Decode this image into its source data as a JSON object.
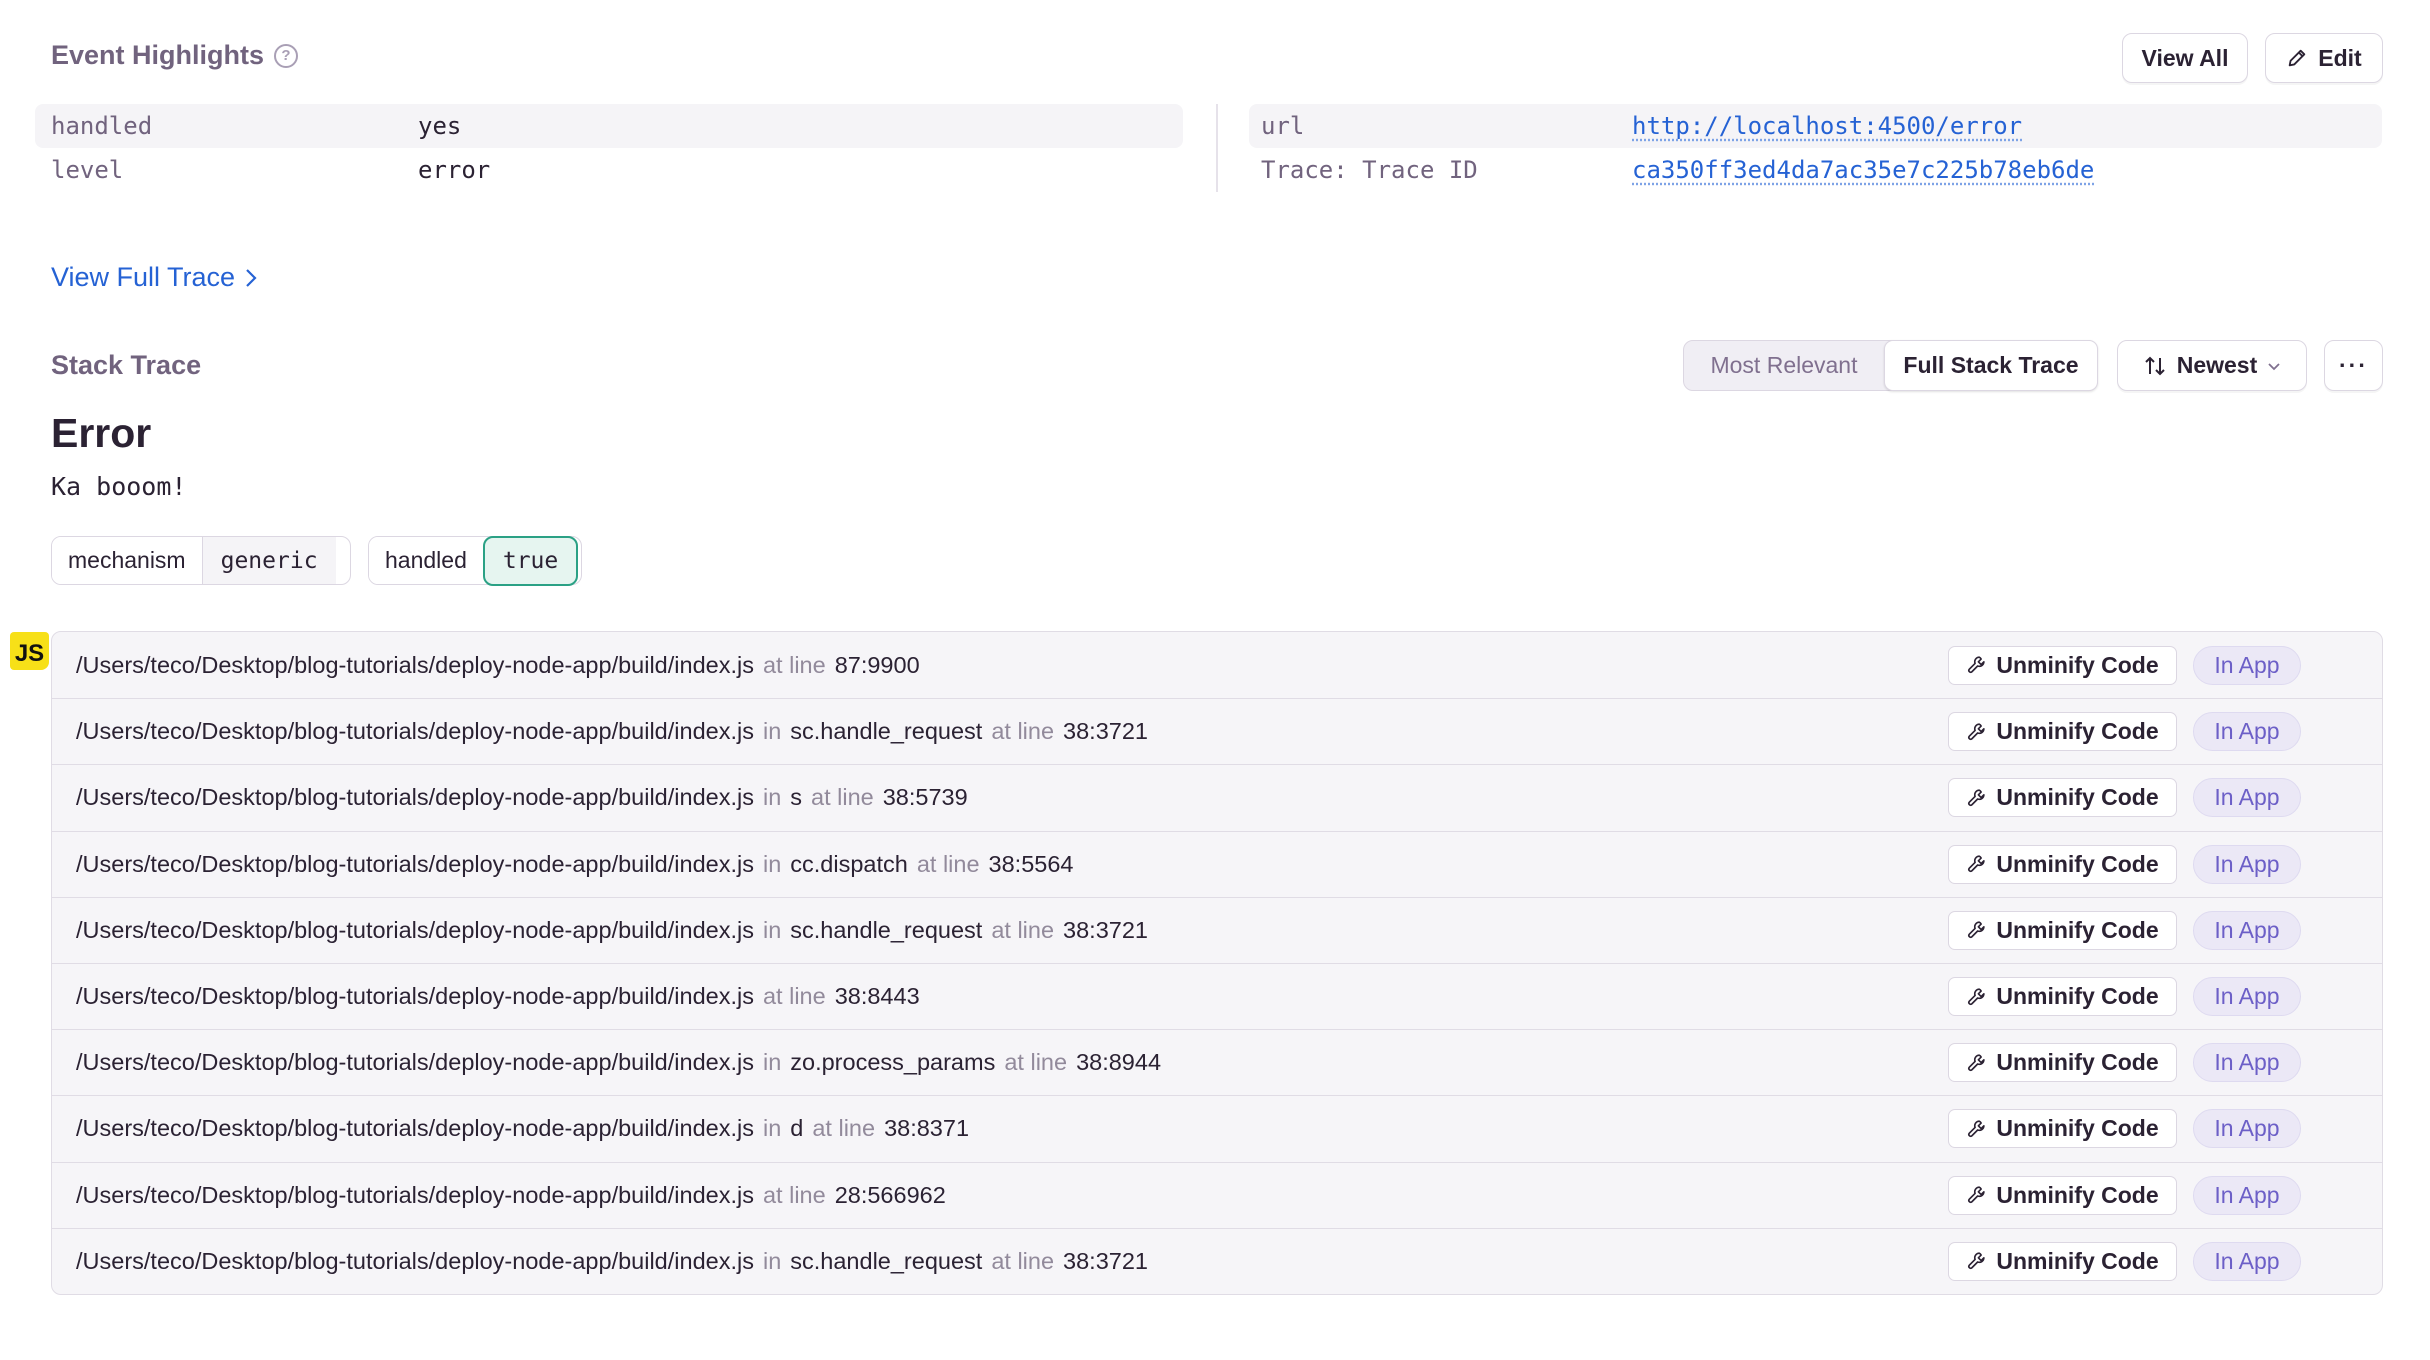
{
  "event_highlights": {
    "title": "Event Highlights",
    "help_icon": "question-circle-icon",
    "view_all_label": "View All",
    "edit_label": "Edit",
    "left": [
      {
        "key": "handled",
        "value": "yes"
      },
      {
        "key": "level",
        "value": "error"
      }
    ],
    "right": [
      {
        "key": "url",
        "value": "http://localhost:4500/error"
      },
      {
        "key": "Trace: Trace ID",
        "value": "ca350ff3ed4da7ac35e7c225b78eb6de"
      }
    ]
  },
  "view_full_trace_label": "View Full Trace",
  "stack_trace": {
    "title": "Stack Trace",
    "view_options": [
      "Most Relevant",
      "Full Stack Trace"
    ],
    "active_view": "Full Stack Trace",
    "sort_label": "Newest",
    "more_label": "···",
    "error_type": "Error",
    "error_message": "Ka booom!",
    "tags": [
      {
        "key": "mechanism",
        "value": "generic"
      },
      {
        "key": "handled",
        "value": "true"
      }
    ],
    "platform_badge": "JS",
    "unminify_label": "Unminify Code",
    "in_app_label": "In App",
    "frames": [
      {
        "file": "/Users/teco/Desktop/blog-tutorials/deploy-node-app/build/index.js",
        "in": "",
        "function": "",
        "at": "at line",
        "line": "87:9900"
      },
      {
        "file": "/Users/teco/Desktop/blog-tutorials/deploy-node-app/build/index.js",
        "in": "in",
        "function": "sc.handle_request",
        "at": "at line",
        "line": "38:3721"
      },
      {
        "file": "/Users/teco/Desktop/blog-tutorials/deploy-node-app/build/index.js",
        "in": "in",
        "function": "s",
        "at": "at line",
        "line": "38:5739"
      },
      {
        "file": "/Users/teco/Desktop/blog-tutorials/deploy-node-app/build/index.js",
        "in": "in",
        "function": "cc.dispatch",
        "at": "at line",
        "line": "38:5564"
      },
      {
        "file": "/Users/teco/Desktop/blog-tutorials/deploy-node-app/build/index.js",
        "in": "in",
        "function": "sc.handle_request",
        "at": "at line",
        "line": "38:3721"
      },
      {
        "file": "/Users/teco/Desktop/blog-tutorials/deploy-node-app/build/index.js",
        "in": "",
        "function": "",
        "at": "at line",
        "line": "38:8443"
      },
      {
        "file": "/Users/teco/Desktop/blog-tutorials/deploy-node-app/build/index.js",
        "in": "in",
        "function": "zo.process_params",
        "at": "at line",
        "line": "38:8944"
      },
      {
        "file": "/Users/teco/Desktop/blog-tutorials/deploy-node-app/build/index.js",
        "in": "in",
        "function": "d",
        "at": "at line",
        "line": "38:8371"
      },
      {
        "file": "/Users/teco/Desktop/blog-tutorials/deploy-node-app/build/index.js",
        "in": "",
        "function": "",
        "at": "at line",
        "line": "28:566962"
      },
      {
        "file": "/Users/teco/Desktop/blog-tutorials/deploy-node-app/build/index.js",
        "in": "in",
        "function": "sc.handle_request",
        "at": "at line",
        "line": "38:3721"
      }
    ]
  },
  "colors": {
    "link": "#2562d4",
    "section_title": "#71637e",
    "handled_true_border": "#2ba185",
    "in_app_text": "#6c5fc7",
    "js_badge": "#f7e018"
  }
}
